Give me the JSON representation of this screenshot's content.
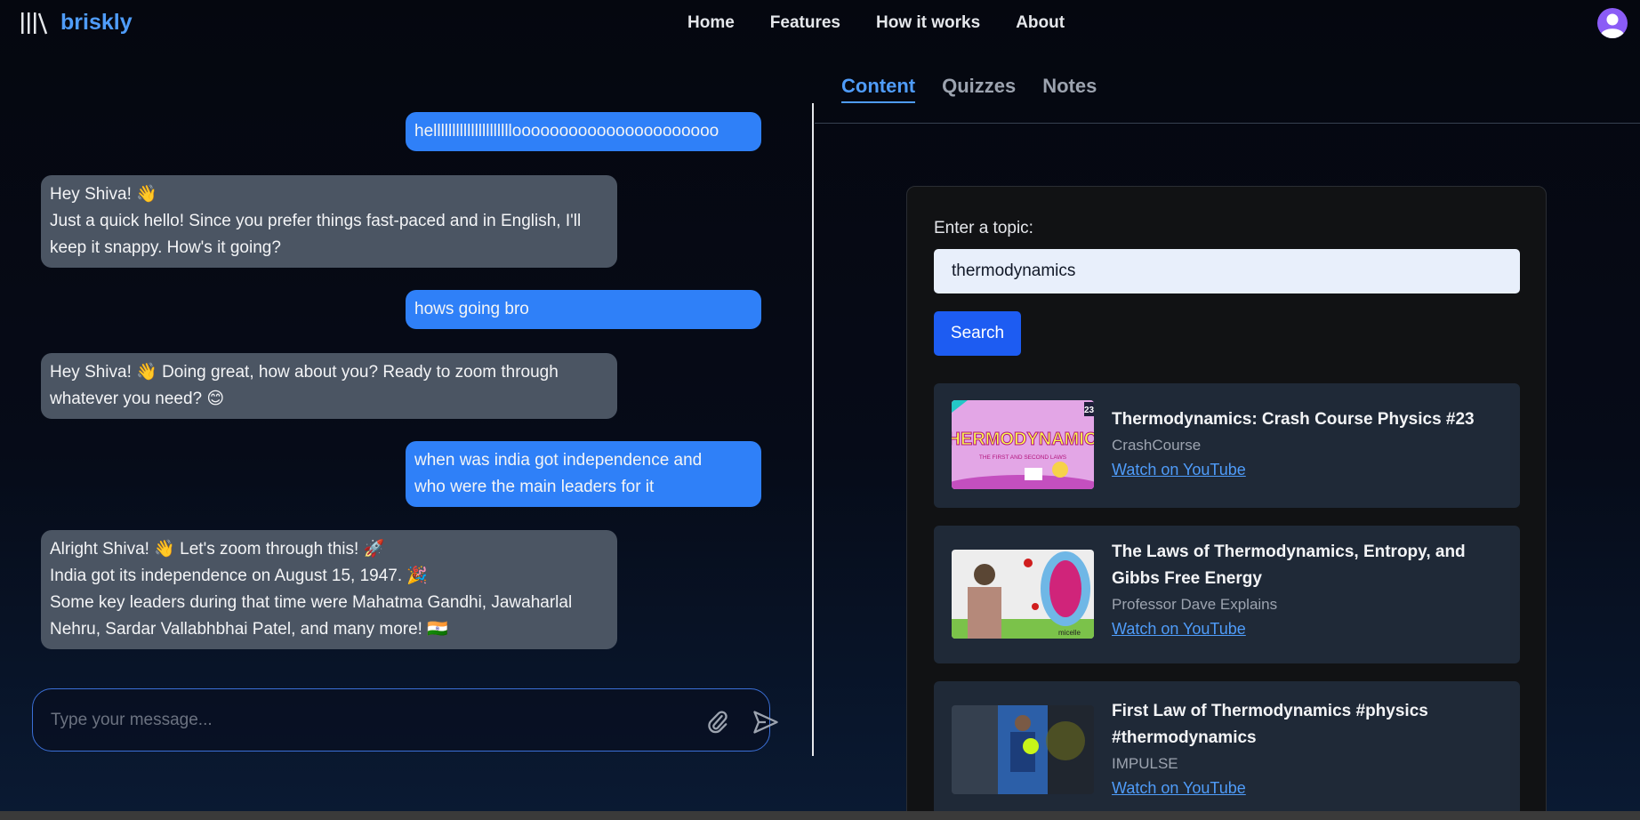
{
  "app": {
    "name": "briskly"
  },
  "nav": {
    "items": [
      "Home",
      "Features",
      "How it works",
      "About"
    ]
  },
  "chat": {
    "messages": [
      {
        "role": "user",
        "lines": [
          "hellllllllllllllllllllloooooooooooooooooooooo"
        ]
      },
      {
        "role": "bot",
        "lines": [
          "Hey Shiva! 👋",
          "Just a quick hello! Since you prefer things fast-paced and in English, I'll",
          "keep it snappy. How's it going?"
        ]
      },
      {
        "role": "user",
        "lines": [
          "hows going bro"
        ]
      },
      {
        "role": "bot",
        "lines": [
          "Hey Shiva! 👋 Doing great, how about you? Ready to zoom through",
          "whatever you need? 😊"
        ]
      },
      {
        "role": "user",
        "lines": [
          "when was india got independence and",
          "who were the main leaders for it"
        ]
      },
      {
        "role": "bot",
        "lines": [
          "Alright Shiva! 👋 Let's zoom through this! 🚀",
          "India got its independence on August 15, 1947. 🎉",
          "Some key leaders during that time were Mahatma Gandhi, Jawaharlal",
          "Nehru, Sardar Vallabhbhai Patel, and many more! 🇮🇳"
        ]
      }
    ],
    "input_placeholder": "Type your message..."
  },
  "tabs": {
    "items": [
      "Content",
      "Quizzes",
      "Notes"
    ],
    "active": "Content"
  },
  "content": {
    "topic_label": "Enter a topic:",
    "topic_value": "thermodynamics",
    "search_label": "Search",
    "videos": [
      {
        "title_lines": [
          "Thermodynamics: Crash Course Physics #23"
        ],
        "channel": "CrashCourse",
        "link": "Watch on YouTube",
        "thumb_text": "THERMODYNAMICS",
        "thumb_sub": "THE FIRST AND SECOND LAWS",
        "thumb_badge": "23"
      },
      {
        "title_lines": [
          "The Laws of Thermodynamics, Entropy, and",
          "Gibbs Free Energy"
        ],
        "channel": "Professor Dave Explains",
        "link": "Watch on YouTube",
        "thumb_label": "micelle"
      },
      {
        "title_lines": [
          "First Law of Thermodynamics #physics",
          "#thermodynamics"
        ],
        "channel": "IMPULSE",
        "link": "Watch on YouTube"
      }
    ]
  },
  "colors": {
    "accent": "#4f9cf9",
    "user_bubble": "#2f80f8",
    "bot_bubble": "#4b5563",
    "search_button": "#1d5cf2",
    "card": "#1f2937"
  }
}
